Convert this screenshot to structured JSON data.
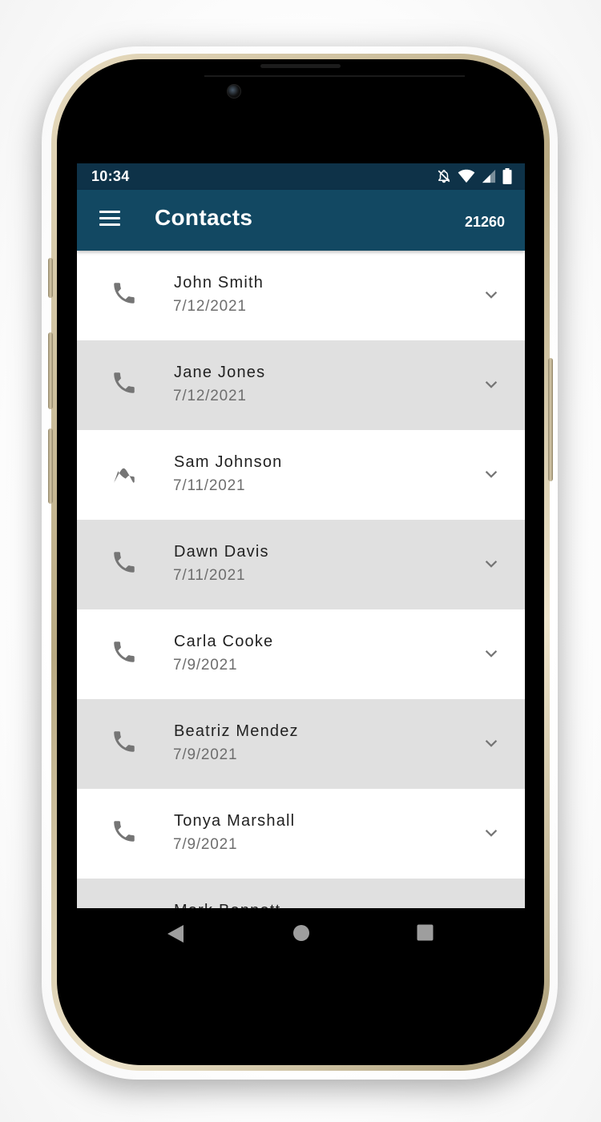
{
  "status_bar": {
    "time": "10:34",
    "icons": [
      "notifications-off-icon",
      "wifi-icon",
      "cell-signal-icon",
      "battery-icon"
    ]
  },
  "app_bar": {
    "menu_icon": "hamburger-menu-icon",
    "title": "Contacts",
    "count": "21260"
  },
  "contacts": [
    {
      "name": "John Smith",
      "date": "7/12/2021"
    },
    {
      "name": "Jane Jones",
      "date": "7/12/2021"
    },
    {
      "name": "Sam Johnson",
      "date": "7/11/2021"
    },
    {
      "name": "Dawn Davis",
      "date": "7/11/2021"
    },
    {
      "name": "Carla Cooke",
      "date": "7/9/2021"
    },
    {
      "name": "Beatriz Mendez",
      "date": "7/9/2021"
    },
    {
      "name": "Tonya Marshall",
      "date": "7/9/2021"
    },
    {
      "name": "Mark Bennett",
      "date": ""
    }
  ],
  "nav_bar": {
    "buttons": [
      "back-icon",
      "home-icon",
      "recents-icon"
    ]
  },
  "colors": {
    "status_bar": "#0e3248",
    "app_bar": "#124862",
    "row_alt": "#e0e0e0",
    "row": "#ffffff",
    "icon_gray": "#757575"
  }
}
